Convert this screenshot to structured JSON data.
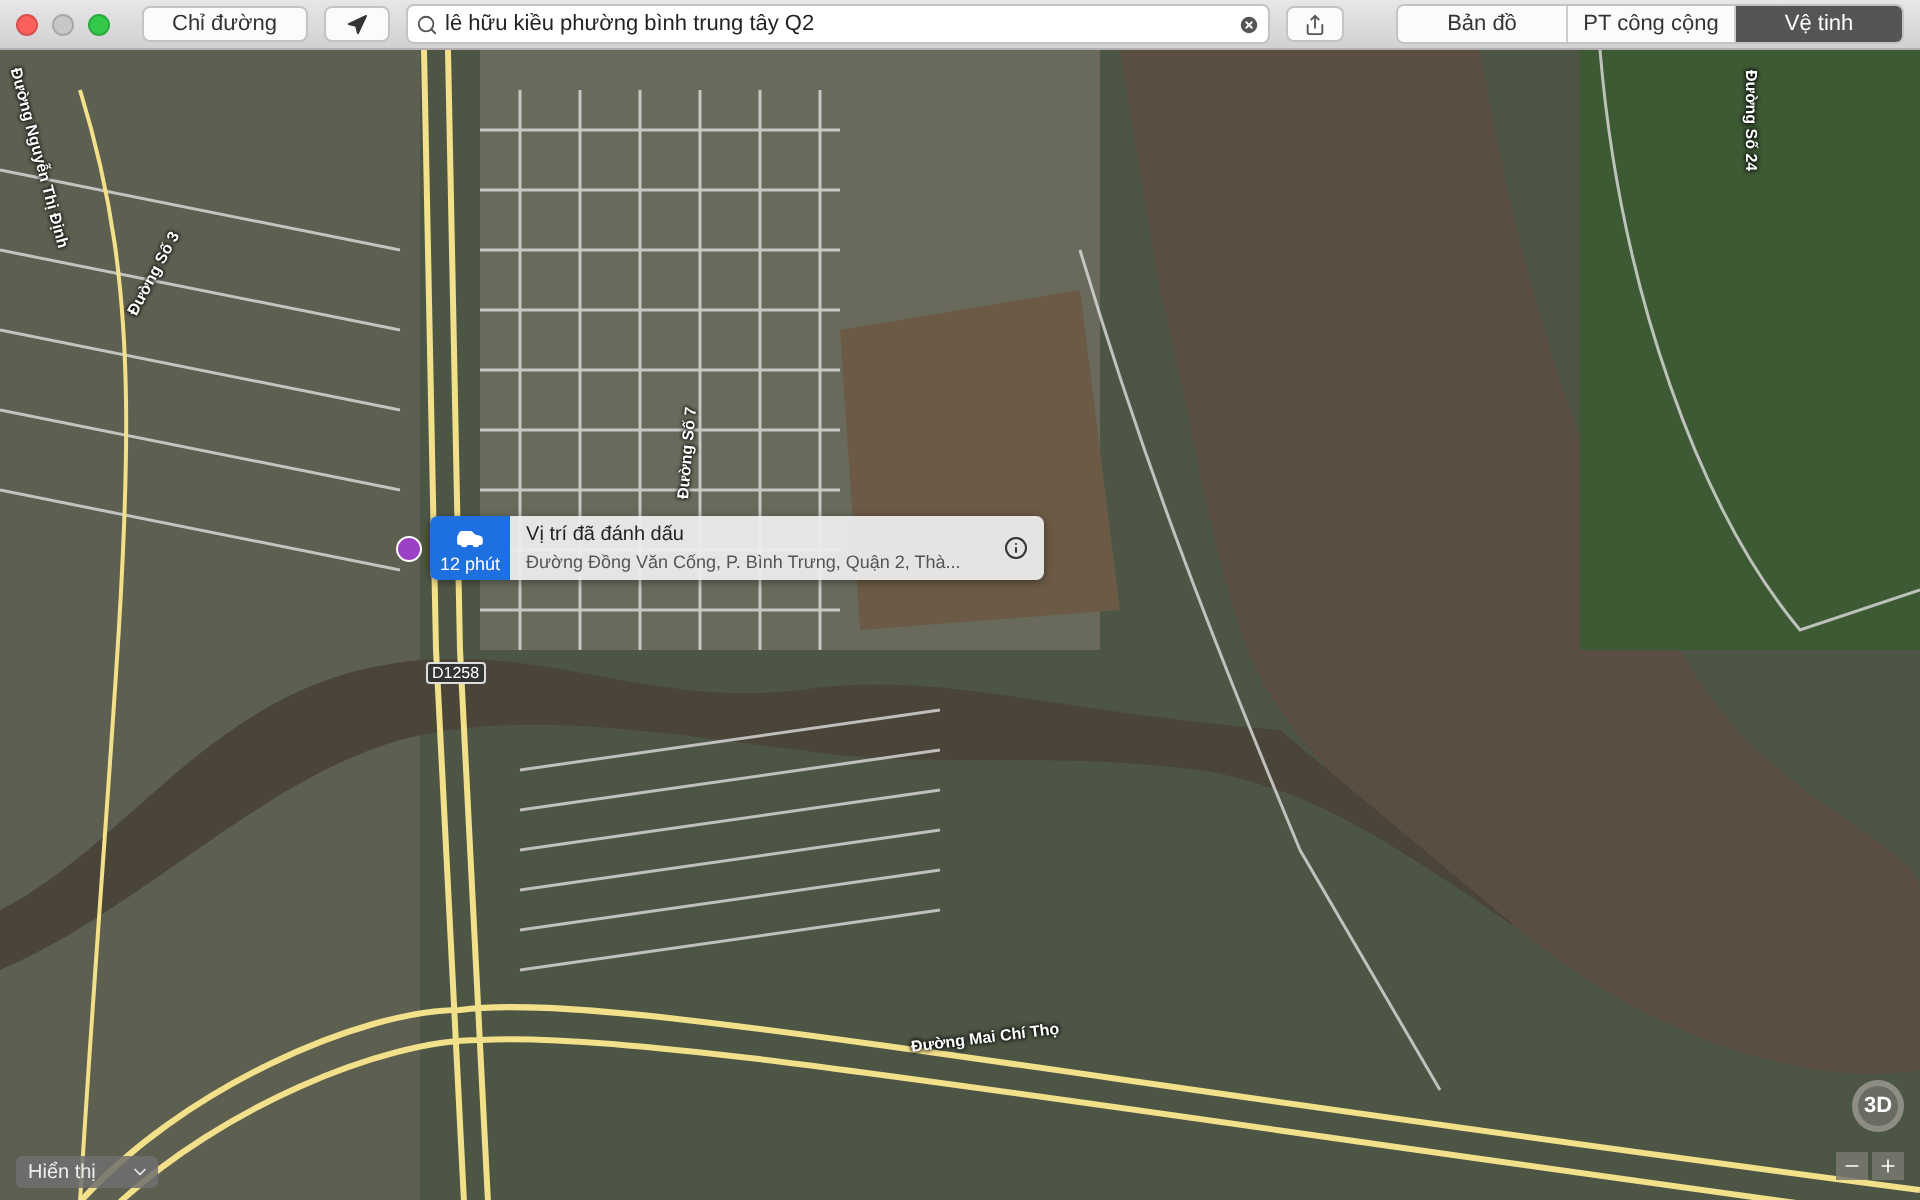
{
  "toolbar": {
    "directions_button": "Chỉ đường",
    "search": {
      "value": "lê hữu kiều phường bình trung tây Q2"
    },
    "map_modes": [
      {
        "label": "Bản đồ",
        "selected": false
      },
      {
        "label": "PT công cộng",
        "selected": false
      },
      {
        "label": "Vệ tinh",
        "selected": true
      }
    ]
  },
  "map": {
    "road_labels": [
      {
        "text": "Đường Nguyễn Thị Định",
        "kind": "vertical"
      },
      {
        "text": "Đường Số 3",
        "kind": "diagonal"
      },
      {
        "text": "Đường Số 7",
        "kind": "vertical"
      },
      {
        "text": "Đường Số 24",
        "kind": "vertical"
      },
      {
        "text": "D1258",
        "kind": "shield"
      },
      {
        "text": "Đường Mai Chí Thọ",
        "kind": "flat"
      }
    ],
    "callout": {
      "travel_time": "12 phút",
      "title": "Vị trí đã đánh dấu",
      "address": "Đường Đồng Văn Cống, P. Bình Trưng, Quận 2, Thà..."
    },
    "view_menu": "Hiển thị",
    "compass_button": "3D"
  }
}
